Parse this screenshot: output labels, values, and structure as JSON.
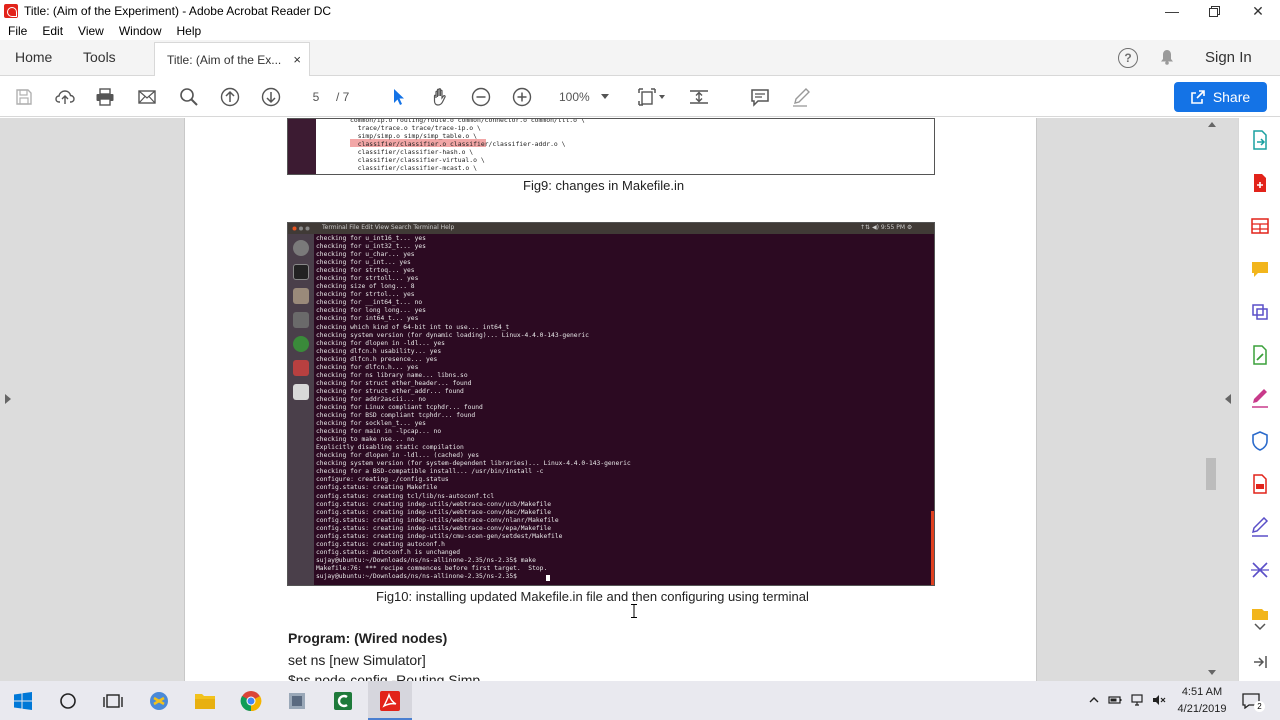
{
  "window": {
    "title": "Title: (Aim of the Experiment) - Adobe Acrobat Reader DC"
  },
  "menu": [
    "File",
    "Edit",
    "View",
    "Window",
    "Help"
  ],
  "tabs": {
    "home": "Home",
    "tools": "Tools",
    "document": "Title: (Aim of the Ex...",
    "close": "×",
    "help": "?",
    "signin": "Sign In"
  },
  "toolbar": {
    "page_current": "5",
    "page_total": "/ 7",
    "zoom": "100%",
    "share_label": "Share"
  },
  "document": {
    "fig9_terminal_lines": "common/ip.o routing/route.o common/connector.o common/ttl.o \\\n  trace/trace.o trace/trace-ip.o \\\n  simp/simp.o simp/simp_table.o \\\n  classifier/classifier.o classifier/classifier-addr.o \\\n  classifier/classifier-hash.o \\\n  classifier/classifier-virtual.o \\\n  classifier/classifier-mcast.o \\",
    "fig9_caption": "Fig9: changes in Makefile.in",
    "fig10_menus": "Terminal   File   Edit   View   Search   Terminal   Help",
    "fig10_status": "↑⇅  ◀)  9:55 PM  ⚙",
    "fig10_terminal_lines": "checking for u_int16_t... yes\nchecking for u_int32_t... yes\nchecking for u_char... yes\nchecking for u_int... yes\nchecking for strtoq... yes\nchecking for strtoll... yes\nchecking size of long... 8\nchecking for strtol... yes\nchecking for __int64_t... no\nchecking for long long... yes\nchecking for int64_t... yes\nchecking which kind of 64-bit int to use... int64_t\nchecking system version (for dynamic loading)... Linux-4.4.0-143-generic\nchecking for dlopen in -ldl... yes\nchecking dlfcn.h usability... yes\nchecking dlfcn.h presence... yes\nchecking for dlfcn.h... yes\nchecking for ns library name... libns.so\nchecking for struct ether_header... found\nchecking for struct ether_addr... found\nchecking for addr2ascii... no\nchecking for Linux compliant tcphdr... found\nchecking for BSD compliant tcphdr... found\nchecking for socklen_t... yes\nchecking for main in -lpcap... no\nchecking to make nse... no\nExplicitly disabling static compilation\nchecking for dlopen in -ldl... (cached) yes\nchecking system version (for system-dependent libraries)... Linux-4.4.0-143-generic\nchecking for a BSD-compatible install... /usr/bin/install -c\nconfigure: creating ./config.status\nconfig.status: creating Makefile\nconfig.status: creating tcl/lib/ns-autoconf.tcl\nconfig.status: creating indep-utils/webtrace-conv/ucb/Makefile\nconfig.status: creating indep-utils/webtrace-conv/dec/Makefile\nconfig.status: creating indep-utils/webtrace-conv/nlanr/Makefile\nconfig.status: creating indep-utils/webtrace-conv/epa/Makefile\nconfig.status: creating indep-utils/cmu-scen-gen/setdest/Makefile\nconfig.status: creating autoconf.h\nconfig.status: autoconf.h is unchanged\nsujay@ubuntu:~/Downloads/ns/ns-allinone-2.35/ns-2.35$ make\nMakefile:76: *** recipe commences before first target.  Stop.\nsujay@ubuntu:~/Downloads/ns/ns-allinone-2.35/ns-2.35$",
    "fig10_caption": "Fig10: installing updated Makefile.in file and then configuring using terminal",
    "program_title": "Program: (Wired nodes)",
    "program_lines": [
      "set ns [new Simulator]",
      "$ns node-config -Routing Simp"
    ]
  },
  "taskbar": {
    "time": "4:51 AM",
    "date": "4/21/2019",
    "notifications": "2"
  },
  "colors": {
    "accent": "#1473e6",
    "terminal_bg": "#2c0a22",
    "acrobat_red": "#e2231a"
  }
}
